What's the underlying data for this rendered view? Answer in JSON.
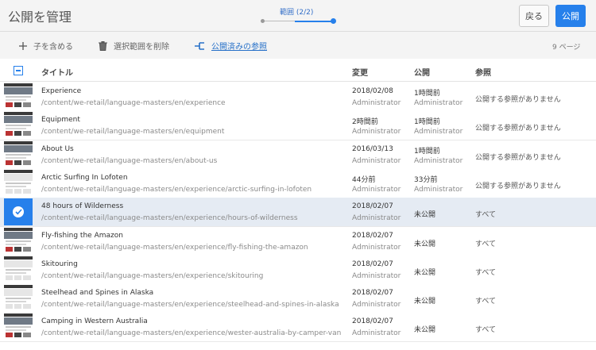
{
  "header": {
    "title": "公開を管理",
    "wizard_step": "範囲 (2/2)",
    "back_label": "戻る",
    "publish_label": "公開"
  },
  "toolbar": {
    "include_children": "子を含める",
    "remove_selection": "選択範囲を削除",
    "published_refs": "公開済みの参照",
    "page_count": "9 ページ"
  },
  "colors": {
    "accent": "#2680eb",
    "link": "#2670c8",
    "selected_row": "#e5ebf3"
  },
  "table": {
    "columns": {
      "title": "タイトル",
      "modified": "変更",
      "published": "公開",
      "references": "参照"
    },
    "rows": [
      {
        "title": "Experience",
        "path": "/content/we-retail/language-masters/en/experience",
        "modified": "2018/02/08",
        "modified_by": "Administrator",
        "published": "1時間前",
        "published_by": "Administrator",
        "references": "公開する参照がありません",
        "selected": false,
        "thumb": "image"
      },
      {
        "title": "Equipment",
        "path": "/content/we-retail/language-masters/en/equipment",
        "modified": "2時間前",
        "modified_by": "Administrator",
        "published": "1時間前",
        "published_by": "Administrator",
        "references": "公開する参照がありません",
        "selected": false,
        "thumb": "image"
      },
      {
        "title": "About Us",
        "path": "/content/we-retail/language-masters/en/about-us",
        "modified": "2016/03/13",
        "modified_by": "Administrator",
        "published": "1時間前",
        "published_by": "Administrator",
        "references": "公開する参照がありません",
        "selected": false,
        "thumb": "image"
      },
      {
        "title": "Arctic Surfing In Lofoten",
        "path": "/content/we-retail/language-masters/en/experience/arctic-surfing-in-lofoten",
        "modified": "44分前",
        "modified_by": "Administrator",
        "published": "33分前",
        "published_by": "Administrator",
        "references": "公開する参照がありません",
        "selected": false,
        "thumb": "blank"
      },
      {
        "title": "48 hours of Wilderness",
        "path": "/content/we-retail/language-masters/en/experience/hours-of-wilderness",
        "modified": "2018/02/07",
        "modified_by": "Administrator",
        "published": "未公開",
        "published_by": "",
        "references": "すべて",
        "selected": true,
        "thumb": "blank"
      },
      {
        "title": "Fly-fishing the Amazon",
        "path": "/content/we-retail/language-masters/en/experience/fly-fishing-the-amazon",
        "modified": "2018/02/07",
        "modified_by": "Administrator",
        "published": "未公開",
        "published_by": "",
        "references": "すべて",
        "selected": false,
        "thumb": "image"
      },
      {
        "title": "Skitouring",
        "path": "/content/we-retail/language-masters/en/experience/skitouring",
        "modified": "2018/02/07",
        "modified_by": "Administrator",
        "published": "未公開",
        "published_by": "",
        "references": "すべて",
        "selected": false,
        "thumb": "blank"
      },
      {
        "title": "Steelhead and Spines in Alaska",
        "path": "/content/we-retail/language-masters/en/experience/steelhead-and-spines-in-alaska",
        "modified": "2018/02/07",
        "modified_by": "Administrator",
        "published": "未公開",
        "published_by": "",
        "references": "すべて",
        "selected": false,
        "thumb": "blank"
      },
      {
        "title": "Camping in Western Australia",
        "path": "/content/we-retail/language-masters/en/experience/wester-australia-by-camper-van",
        "modified": "2018/02/07",
        "modified_by": "Administrator",
        "published": "未公開",
        "published_by": "",
        "references": "すべて",
        "selected": false,
        "thumb": "image"
      }
    ]
  }
}
